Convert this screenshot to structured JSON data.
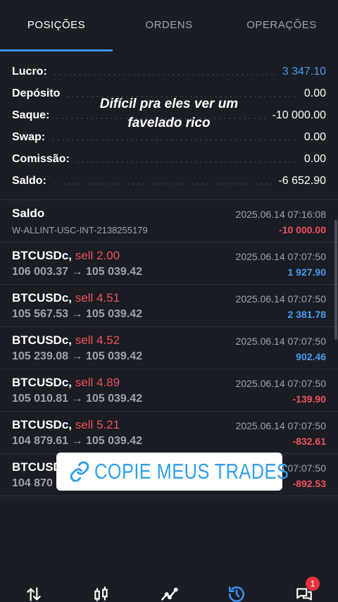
{
  "tabs": [
    {
      "label": "POSIÇÕES",
      "active": true
    },
    {
      "label": "ORDENS",
      "active": false
    },
    {
      "label": "OPERAÇÕES",
      "active": false
    }
  ],
  "summary": [
    {
      "label": "Lucro:",
      "value": "3 347.10"
    },
    {
      "label": "Depósito",
      "value": "0.00"
    },
    {
      "label": "Saque:",
      "value": "-10 000.00"
    },
    {
      "label": "Swap:",
      "value": "0.00"
    },
    {
      "label": "Comissão:",
      "value": "0.00"
    },
    {
      "label": "Saldo:",
      "value": "-6 652.90"
    }
  ],
  "caption": {
    "line1": "Difícil pra eles ver um",
    "line2": "favelado rico"
  },
  "balance_entry": {
    "title": "Saldo",
    "detail": "W-ALLINT-USC-INT-2138255179",
    "date": "2025.06.14 07:16:08",
    "amount": "-10 000.00"
  },
  "trades": [
    {
      "symbol": "BTCUSDc,",
      "side": "sell 2.00",
      "prices": "106 003.37 → 105 039.42",
      "date": "2025.06.14 07:07:50",
      "profit": "1 927.90",
      "positive": true
    },
    {
      "symbol": "BTCUSDc,",
      "side": "sell 4.51",
      "prices": "105 567.53 → 105 039.42",
      "date": "2025.06.14 07:07:50",
      "profit": "2 381.78",
      "positive": true
    },
    {
      "symbol": "BTCUSDc,",
      "side": "sell 4.52",
      "prices": "105 239.08 → 105 039.42",
      "date": "2025.06.14 07:07:50",
      "profit": "902.46",
      "positive": true
    },
    {
      "symbol": "BTCUSDc,",
      "side": "sell 4.89",
      "prices": "105 010.81 → 105 039.42",
      "date": "2025.06.14 07:07:50",
      "profit": "-139.90",
      "positive": false
    },
    {
      "symbol": "BTCUSDc,",
      "side": "sell 5.21",
      "prices": "104 879.61 → 105 039.42",
      "date": "2025.06.14 07:07:50",
      "profit": "-832.61",
      "positive": false
    },
    {
      "symbol": "BTCUSD",
      "side": "",
      "prices": "104 870",
      "date": "4 07:07:50",
      "profit": "-892.53",
      "positive": false
    }
  ],
  "promo": {
    "label": "COPIE MEUS TRADES",
    "icon": "link-icon"
  },
  "bottom_nav": [
    {
      "icon": "quotes-arrows-icon"
    },
    {
      "icon": "candlestick-chart-icon"
    },
    {
      "icon": "line-chart-icon"
    },
    {
      "icon": "history-clock-icon",
      "active": true
    },
    {
      "icon": "chat-icon",
      "badge": "1"
    }
  ],
  "colors": {
    "background": "#1a1d23",
    "accent": "#3d8ff5",
    "profit": "#4a9af5",
    "loss": "#f0515a",
    "muted": "#9ea3ab"
  }
}
